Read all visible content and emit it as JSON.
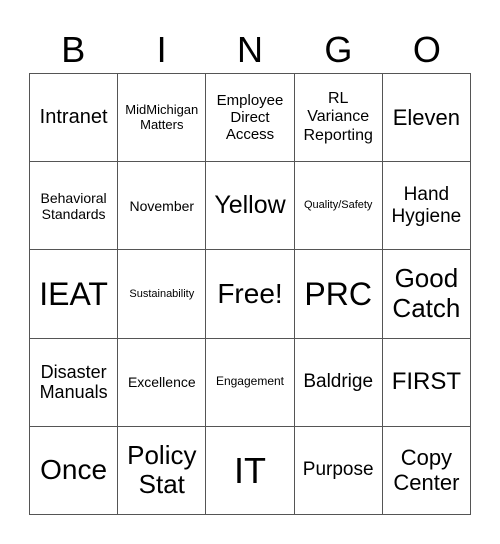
{
  "header": [
    "B",
    "I",
    "N",
    "G",
    "O"
  ],
  "cells": [
    [
      "Intranet",
      "MidMichigan\nMatters",
      "Employee\nDirect\nAccess",
      "RL\nVariance\nReporting",
      "Eleven"
    ],
    [
      "Behavioral\nStandards",
      "November",
      "Yellow",
      "Quality/Safety",
      "Hand\nHygiene"
    ],
    [
      "IEAT",
      "Sustainability",
      "Free!",
      "PRC",
      "Good\nCatch"
    ],
    [
      "Disaster\nManuals",
      "Excellence",
      "Engagement",
      "Baldrige",
      "FIRST"
    ],
    [
      "Once",
      "Policy\nStat",
      "IT",
      "Purpose",
      "Copy\nCenter"
    ]
  ]
}
